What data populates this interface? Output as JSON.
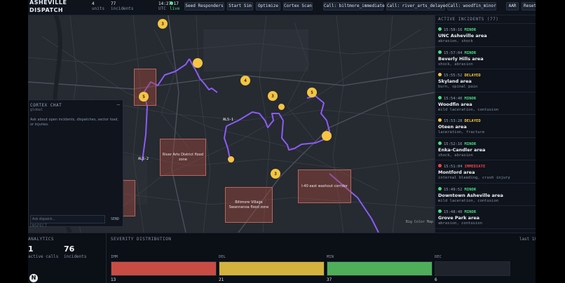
{
  "header": {
    "title": "ASHEVILLE DISPATCH",
    "units_value": "4",
    "units_label": "units",
    "incidents_value": "77",
    "incidents_label": "incidents",
    "clock": "14:27:17",
    "clock_tz": "UTC",
    "live_label": "live",
    "buttons": [
      "Seed Responders",
      "Start Sim",
      "Optimize",
      "Cortex Scan",
      "Call: biltmore_immediate",
      "Call: river_arts_delayed",
      "Call: woodfin_minor",
      "AAR",
      "Reset"
    ]
  },
  "map": {
    "clusters": [
      "3",
      "5",
      "4",
      "3",
      "5",
      "3"
    ],
    "zones": [
      "River Arts District flood zone",
      "Biltmore Village Swannanoa flood zone",
      "I-40 east washout corridor"
    ],
    "unit_tags": [
      "ALS-1",
      "ALS-2"
    ],
    "credit": "Big Color Map",
    "colors": {
      "route": "#8b5cf6",
      "cluster": "#f5c542",
      "zone": "#b9665b"
    }
  },
  "chat": {
    "title": "CORTEX CHAT",
    "subtitle": "global",
    "help": "Ask about open incidents, dispatches, sector load, or injuries.",
    "input_placeholder": "Ask dispatch...",
    "send_label": "SEND",
    "footer_text": "INSPECT"
  },
  "incidents": {
    "header": "ACTIVE INCIDENTS (77)",
    "items": [
      {
        "time": "15:58:16",
        "severity": "MINOR",
        "color": "#4ade80",
        "area": "UNC Asheville area",
        "injuries": "abrasion, shock"
      },
      {
        "time": "15:57:04",
        "severity": "MINOR",
        "color": "#4ade80",
        "area": "Beverly Hills area",
        "injuries": "shock, abrasion"
      },
      {
        "time": "15:55:52",
        "severity": "DELAYED",
        "color": "#f5c542",
        "area": "Skyland area",
        "injuries": "burn, spinal pain"
      },
      {
        "time": "15:54:40",
        "severity": "MINOR",
        "color": "#4ade80",
        "area": "Woodfin area",
        "injuries": "mild laceration, contusion"
      },
      {
        "time": "15:53:28",
        "severity": "DELAYED",
        "color": "#f5c542",
        "area": "Oteen area",
        "injuries": "laceration, fracture"
      },
      {
        "time": "15:52:16",
        "severity": "MINOR",
        "color": "#4ade80",
        "area": "Enka-Candler area",
        "injuries": "shock, abrasion"
      },
      {
        "time": "15:51:04",
        "severity": "IMMEDIATE",
        "color": "#ef4444",
        "area": "Montford area",
        "injuries": "internal bleeding, crush injury"
      },
      {
        "time": "15:49:52",
        "severity": "MINOR",
        "color": "#4ade80",
        "area": "Downtown Asheville area",
        "injuries": "mild laceration, contusion"
      },
      {
        "time": "15:48:40",
        "severity": "MINOR",
        "color": "#4ade80",
        "area": "Grove Park area",
        "injuries": "abrasion, contusion"
      }
    ]
  },
  "analytics": {
    "title": "ANALYTICS",
    "calls_value": "1",
    "calls_label": "active calls",
    "incidents_value": "76",
    "incidents_label": "incidents"
  },
  "severity": {
    "title": "SEVERITY DISTRIBUTION",
    "range": "last 10",
    "bars": [
      {
        "label": "IMM",
        "count": "13",
        "color": "#c94c44"
      },
      {
        "label": "DEL",
        "count": "21",
        "color": "#d4b23e"
      },
      {
        "label": "MIN",
        "count": "37",
        "color": "#4fae5a"
      },
      {
        "label": "DEC",
        "count": "6",
        "color": "#1f242c"
      }
    ]
  }
}
